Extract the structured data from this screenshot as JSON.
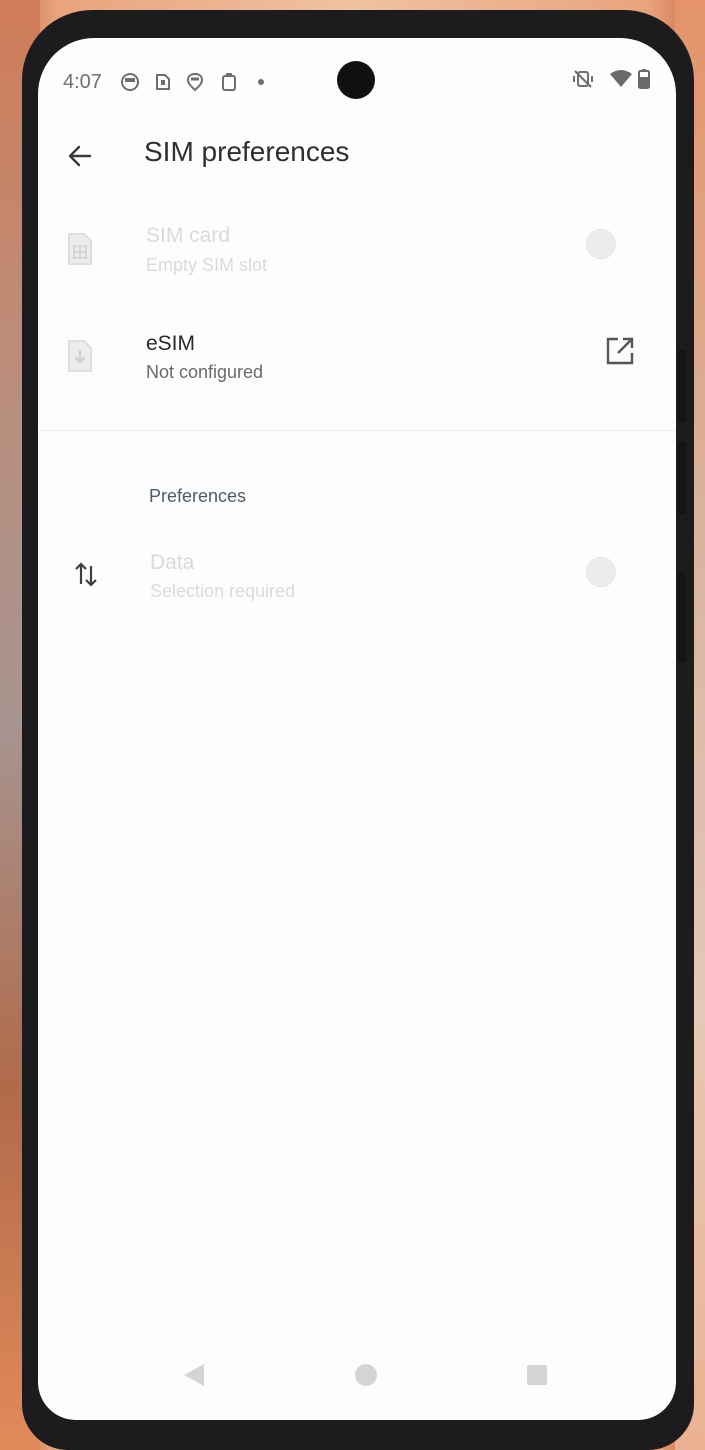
{
  "status_bar": {
    "time": "4:07",
    "notification_icons": [
      "vpn-lock-icon",
      "sim-alert-icon",
      "shield-icon",
      "clipboard-icon",
      "dot-icon"
    ],
    "right_icons": [
      "vibrate-off-icon",
      "wifi-icon",
      "battery-icon"
    ]
  },
  "app_bar": {
    "back_icon": "arrow-left-icon",
    "title": "SIM preferences"
  },
  "sims": [
    {
      "title": "SIM card",
      "subtitle": "Empty SIM slot",
      "icon": "sim-card-icon",
      "enabled": false,
      "control": "radio"
    },
    {
      "title": "eSIM",
      "subtitle": "Not configured",
      "icon": "esim-download-icon",
      "enabled": true,
      "control": "open-external-icon"
    }
  ],
  "preferences": {
    "header": "Preferences",
    "items": [
      {
        "title": "Data",
        "subtitle": "Selection required",
        "icon": "swap-vert-arrows-icon",
        "enabled": false,
        "control": "radio"
      }
    ]
  },
  "nav_bar": {
    "buttons": [
      "nav-back-icon",
      "nav-home-icon",
      "nav-recents-icon"
    ]
  },
  "colors": {
    "screen_bg": "#fdfdfd",
    "title_text": "#2f2f33",
    "disabled_text": "#dadada",
    "section_header": "#4f5b68"
  }
}
